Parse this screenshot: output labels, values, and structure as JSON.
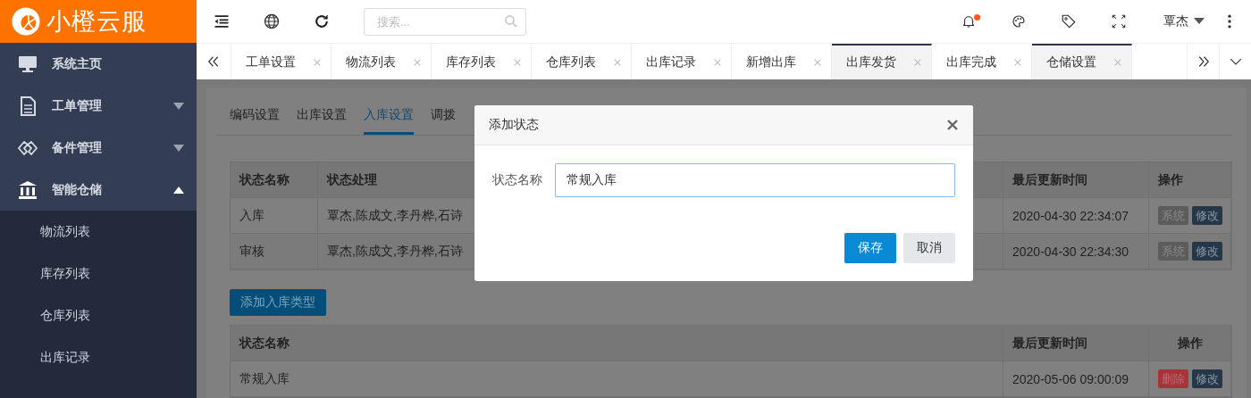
{
  "logo": {
    "text": "小橙云服"
  },
  "header": {
    "search": {
      "placeholder": "搜索..."
    },
    "notification_dot": true,
    "user": {
      "name": "覃杰"
    }
  },
  "sidebar": {
    "items": [
      {
        "label": "系统主页",
        "kind": "link"
      },
      {
        "label": "工单管理",
        "kind": "group",
        "expanded": false
      },
      {
        "label": "备件管理",
        "kind": "group",
        "expanded": false
      },
      {
        "label": "智能仓储",
        "kind": "group",
        "expanded": true,
        "children": [
          {
            "label": "物流列表"
          },
          {
            "label": "库存列表"
          },
          {
            "label": "仓库列表"
          },
          {
            "label": "出库记录"
          }
        ]
      }
    ]
  },
  "tabs": [
    {
      "label": "工单设置",
      "selected": false
    },
    {
      "label": "物流列表",
      "selected": false
    },
    {
      "label": "库存列表",
      "selected": false
    },
    {
      "label": "仓库列表",
      "selected": false
    },
    {
      "label": "出库记录",
      "selected": false
    },
    {
      "label": "新增出库",
      "selected": false
    },
    {
      "label": "出库发货",
      "selected": true
    },
    {
      "label": "出库完成",
      "selected": false
    },
    {
      "label": "仓储设置",
      "selected": true
    }
  ],
  "content": {
    "subtabs": [
      {
        "label": "编码设置",
        "selected": false
      },
      {
        "label": "出库设置",
        "selected": false
      },
      {
        "label": "入库设置",
        "selected": true
      },
      {
        "label": "调拨",
        "selected": false
      }
    ],
    "status_table": {
      "columns": [
        "状态名称",
        "状态处理",
        "最后更新时间",
        "操作"
      ],
      "rows": [
        {
          "cells": [
            "入库",
            "覃杰,陈成文,李丹桦,石诗",
            "2020-04-30 22:34:07"
          ],
          "actions": [
            {
              "label": "系统",
              "kind": "system"
            },
            {
              "label": "修改",
              "kind": "edit"
            }
          ]
        },
        {
          "cells": [
            "审核",
            "覃杰,陈成文,李丹桦,石诗",
            "2020-04-30 22:34:30"
          ],
          "actions": [
            {
              "label": "系统",
              "kind": "system"
            },
            {
              "label": "修改",
              "kind": "edit"
            }
          ]
        }
      ]
    },
    "add_button": "添加入库类型",
    "type_table": {
      "columns": [
        "状态名称",
        "最后更新时间",
        "操作"
      ],
      "rows": [
        {
          "cells": [
            "常规入库",
            "2020-05-06 09:00:09"
          ],
          "actions": [
            {
              "label": "删除",
              "kind": "delete"
            },
            {
              "label": "修改",
              "kind": "edit"
            }
          ]
        }
      ]
    }
  },
  "modal": {
    "title": "添加状态",
    "field": {
      "label": "状态名称",
      "value": "常规入库"
    },
    "buttons": [
      {
        "label": "保存",
        "kind": "primary"
      },
      {
        "label": "取消",
        "kind": "default"
      }
    ]
  }
}
